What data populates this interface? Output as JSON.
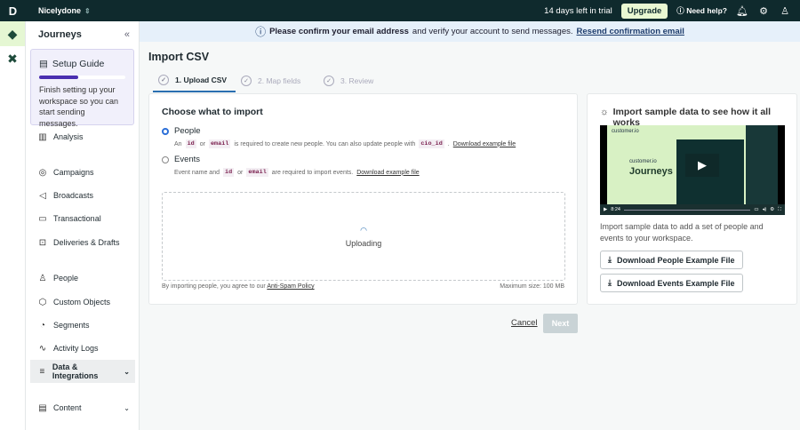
{
  "topbar": {
    "workspace": "Nicelydone",
    "trial": "14 days left in trial",
    "upgrade": "Upgrade",
    "help": "Need help?"
  },
  "banner": {
    "bold": "Please confirm your email address",
    "text": "and verify your account to send messages.",
    "link": "Resend confirmation email"
  },
  "sidebar": {
    "title": "Journeys",
    "guide": {
      "title": "Setup Guide",
      "progress": 0.45,
      "text": "Finish setting up your workspace so you can start sending messages."
    },
    "items": [
      {
        "label": "Analysis",
        "icon": "▥"
      },
      {
        "label": "Campaigns",
        "icon": "◎"
      },
      {
        "label": "Broadcasts",
        "icon": "◁"
      },
      {
        "label": "Transactional",
        "icon": "▭"
      },
      {
        "label": "Deliveries & Drafts",
        "icon": "⊡"
      },
      {
        "label": "People",
        "icon": "♙"
      },
      {
        "label": "Custom Objects",
        "icon": "⬡"
      },
      {
        "label": "Segments",
        "icon": "◔"
      },
      {
        "label": "Activity Logs",
        "icon": "∿"
      },
      {
        "label": "Data & Integrations",
        "icon": "≡"
      },
      {
        "label": "Content",
        "icon": "▤"
      }
    ]
  },
  "page": {
    "title": "Import CSV",
    "tabs": [
      "1. Upload CSV",
      "2. Map fields",
      "3. Review"
    ]
  },
  "import": {
    "heading": "Choose what to import",
    "people": {
      "label": "People",
      "an": "An",
      "id": "id",
      "or": "or",
      "email": "email",
      "text": "is required to create new people. You can also update people with",
      "cio": "cio_id",
      "dot": ".",
      "link": "Download example file"
    },
    "events": {
      "label": "Events",
      "pre": "Event name and",
      "id": "id",
      "or": "or",
      "email": "email",
      "text": "are required to import events.",
      "link": "Download example file"
    },
    "uploading": "Uploading",
    "agree": "By importing people, you agree to our",
    "policy": "Anti-Spam Policy",
    "max": "Maximum size: 100 MB"
  },
  "sample": {
    "title": "Import sample data to see how it all works",
    "video": {
      "brand": "customer.io",
      "product": "Journeys",
      "time": "8:24"
    },
    "desc": "Import sample data to add a set of people and events to your workspace.",
    "people_btn": "Download People Example File",
    "events_btn": "Download Events Example File"
  },
  "actions": {
    "cancel": "Cancel",
    "next": "Next"
  }
}
